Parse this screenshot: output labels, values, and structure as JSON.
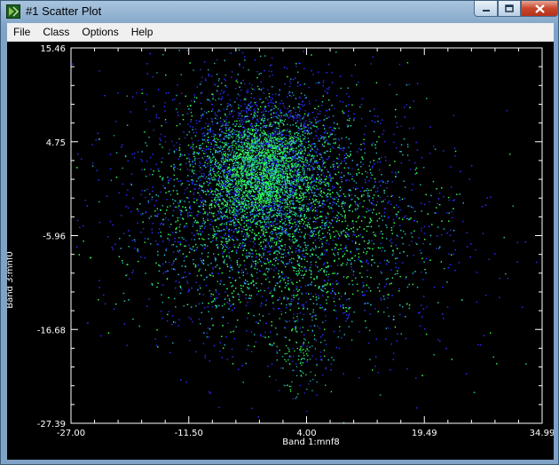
{
  "window": {
    "title": "#1 Scatter Plot"
  },
  "menu": {
    "items": [
      "File",
      "Class",
      "Options",
      "Help"
    ]
  },
  "chart_data": {
    "type": "scatter",
    "xlabel": "Band 1:mnf8",
    "ylabel": "Band 3:mnf0",
    "xlim": [
      -27.0,
      34.99
    ],
    "ylim": [
      -27.39,
      15.46
    ],
    "xticks": [
      "-27.00",
      "-11.50",
      "4.00",
      "19.49",
      "34.99"
    ],
    "yticks": [
      "15.46",
      "4.75",
      "-5.96",
      "-16.68",
      "-27.39"
    ],
    "clusters": [
      {
        "cx": -2.0,
        "cy": 1.5,
        "sx": 3.8,
        "sy": 3.6,
        "n": 3500
      },
      {
        "cx": -1.5,
        "cy": 0.0,
        "sx": 7.5,
        "sy": 6.5,
        "n": 5000
      },
      {
        "cx": 1.5,
        "cy": -6.0,
        "sx": 11.5,
        "sy": 7.0,
        "n": 5000
      },
      {
        "cx": 3.0,
        "cy": -19.0,
        "sx": 1.8,
        "sy": 3.0,
        "n": 150
      }
    ],
    "colors": {
      "background": "#000000",
      "sparse": "#2a2cff",
      "medium": "#22b8b8",
      "dense": "#33ff55"
    }
  }
}
